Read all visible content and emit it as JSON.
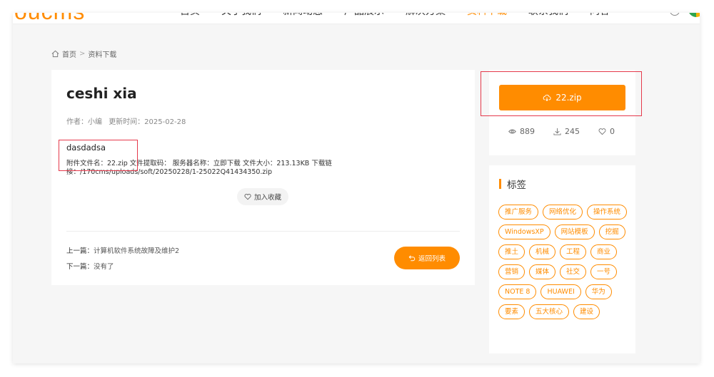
{
  "nav": {
    "logo": "oucms",
    "items": [
      "首页",
      "关于我们",
      "新闻动态",
      "产品展示",
      "解决方案",
      "资料下载",
      "联系我们",
      "问答"
    ],
    "active_index": 5
  },
  "breadcrumb": {
    "home": "首页",
    "separator": ">",
    "current": "资料下载"
  },
  "article": {
    "title": "ceshi xia",
    "author": "作者：小编",
    "updated": "更新时间：2025-02-28",
    "description": "dasdadsa",
    "file_info": "附件文件名：22.zip 文件提取码：  服务器名称：立即下载 文件大小：213.13KB 下载链接：/170cms/uploads/soft/20250228/1-25022Q41434350.zip",
    "favorite_label": "加入收藏",
    "prev_label": "上一篇：",
    "prev_title": "计算机软件系统故障及维护2",
    "next_label": "下一篇：",
    "next_title": "没有了",
    "back_label": "返回列表"
  },
  "download": {
    "button_label": "22.zip",
    "views": "889",
    "downloads": "245",
    "likes": "0"
  },
  "tags": {
    "heading": "标签",
    "items": [
      "推广服务",
      "网络优化",
      "操作系统",
      "WindowsXP",
      "网站模板",
      "挖掘",
      "推土",
      "机械",
      "工程",
      "商业",
      "营销",
      "媒体",
      "社交",
      "一号",
      "NOTE 8",
      "HUAWEI",
      "华为",
      "要素",
      "五大核心",
      "建设"
    ]
  },
  "colors": {
    "accent": "#ff8c00",
    "highlight": "#e5394b"
  }
}
